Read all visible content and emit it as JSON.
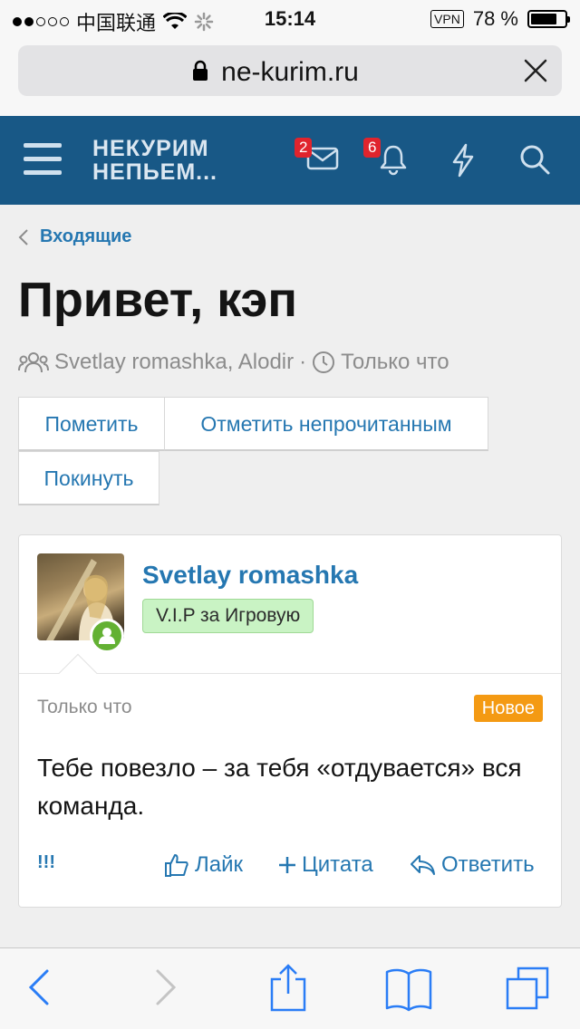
{
  "status_bar": {
    "carrier": "中国联通",
    "time": "15:14",
    "vpn": "VPN",
    "battery": "78 %",
    "battery_level": 0.78
  },
  "browser": {
    "url": "ne-kurim.ru"
  },
  "header": {
    "logo_line1": "НЕКУРИМ",
    "logo_line2": "НЕПЬЕМ...",
    "inbox_count": "2",
    "alerts_count": "6"
  },
  "breadcrumb": {
    "label": "Входящие"
  },
  "conversation": {
    "title": "Привет, кэп",
    "participants": "Svetlay romashka, Alodir",
    "separator": "·",
    "time": "Только что"
  },
  "buttons": {
    "mark": "Пометить",
    "mark_unread": "Отметить непрочитанным",
    "leave": "Покинуть"
  },
  "post": {
    "username": "Svetlay romashka",
    "user_title": "V.I.P за Игровую",
    "time": "Только что",
    "new_badge": "Новое",
    "message": "Тебе повезло – за тебя «отдувается» вся команда.",
    "report": "!!!",
    "like": "Лайк",
    "quote": "Цитата",
    "reply": "Ответить"
  },
  "colors": {
    "header_bg": "#185886",
    "link": "#2577b1",
    "badge_red": "#e0242d",
    "new_orange": "#f49a13",
    "user_title_bg": "#c9f3c4"
  }
}
